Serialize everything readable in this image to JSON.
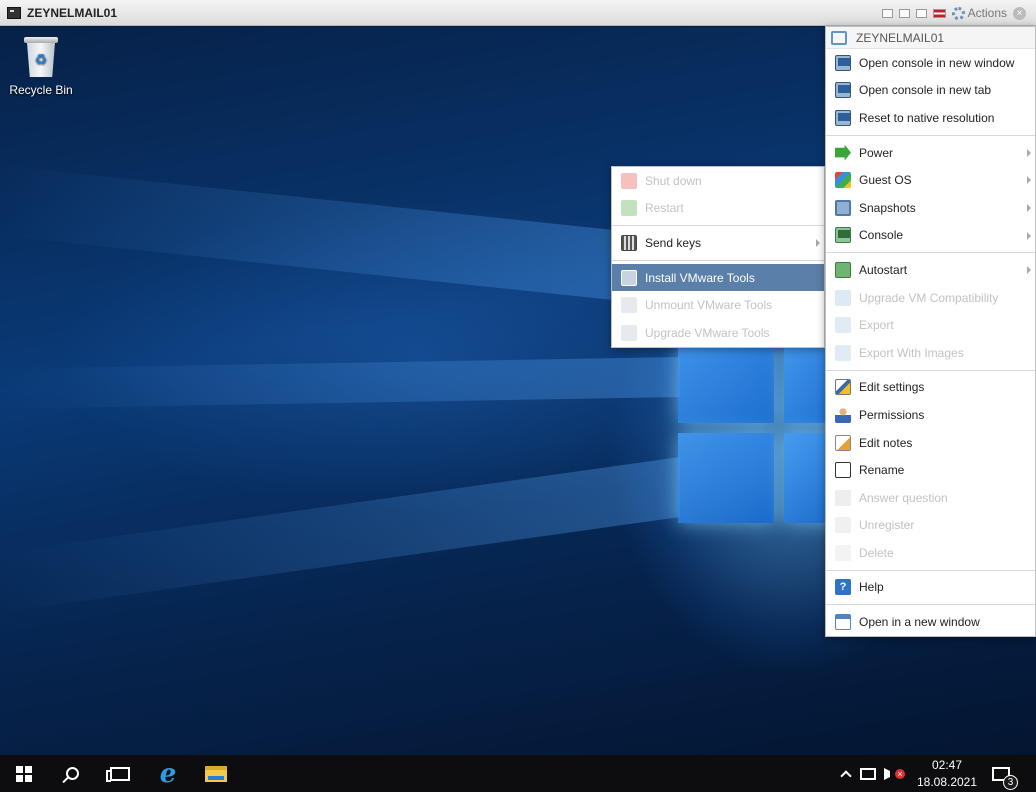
{
  "window": {
    "title": "ZEYNELMAIL01",
    "actions_label": "Actions",
    "icons": [
      "terminal-icon",
      "minimize-icon",
      "restore-icon",
      "maximize-icon",
      "flag-icon",
      "gear-icon",
      "close-icon"
    ]
  },
  "desktop": {
    "recycle_bin_label": "Recycle Bin"
  },
  "actions_menu": {
    "header": "ZEYNELMAIL01",
    "items": [
      {
        "label": "Open console in new window",
        "enabled": true,
        "submenu": false
      },
      {
        "label": "Open console in new tab",
        "enabled": true,
        "submenu": false
      },
      {
        "label": "Reset to native resolution",
        "enabled": true,
        "submenu": false
      },
      {
        "label": "Power",
        "enabled": true,
        "submenu": true
      },
      {
        "label": "Guest OS",
        "enabled": true,
        "submenu": true
      },
      {
        "label": "Snapshots",
        "enabled": true,
        "submenu": true
      },
      {
        "label": "Console",
        "enabled": true,
        "submenu": true
      },
      {
        "label": "Autostart",
        "enabled": true,
        "submenu": true
      },
      {
        "label": "Upgrade VM Compatibility",
        "enabled": false,
        "submenu": false
      },
      {
        "label": "Export",
        "enabled": false,
        "submenu": false
      },
      {
        "label": "Export With Images",
        "enabled": false,
        "submenu": false
      },
      {
        "label": "Edit settings",
        "enabled": true,
        "submenu": false
      },
      {
        "label": "Permissions",
        "enabled": true,
        "submenu": false
      },
      {
        "label": "Edit notes",
        "enabled": true,
        "submenu": false
      },
      {
        "label": "Rename",
        "enabled": true,
        "submenu": false
      },
      {
        "label": "Answer question",
        "enabled": false,
        "submenu": false
      },
      {
        "label": "Unregister",
        "enabled": false,
        "submenu": false
      },
      {
        "label": "Delete",
        "enabled": false,
        "submenu": false
      },
      {
        "label": "Help",
        "enabled": true,
        "submenu": false
      },
      {
        "label": "Open in a new window",
        "enabled": true,
        "submenu": false
      }
    ]
  },
  "guest_os_menu": {
    "items": [
      {
        "label": "Shut down",
        "enabled": false,
        "submenu": false
      },
      {
        "label": "Restart",
        "enabled": false,
        "submenu": false
      },
      {
        "label": "Send keys",
        "enabled": true,
        "submenu": true
      },
      {
        "label": "Install VMware Tools",
        "enabled": true,
        "submenu": false,
        "highlighted": true
      },
      {
        "label": "Unmount VMware Tools",
        "enabled": false,
        "submenu": false
      },
      {
        "label": "Upgrade VMware Tools",
        "enabled": false,
        "submenu": false
      }
    ]
  },
  "taskbar": {
    "time": "02:47",
    "date": "18.08.2021",
    "notification_count": "3",
    "pinned": [
      "start-icon",
      "search-icon",
      "task-view-icon",
      "internet-explorer-icon",
      "file-explorer-icon"
    ]
  }
}
